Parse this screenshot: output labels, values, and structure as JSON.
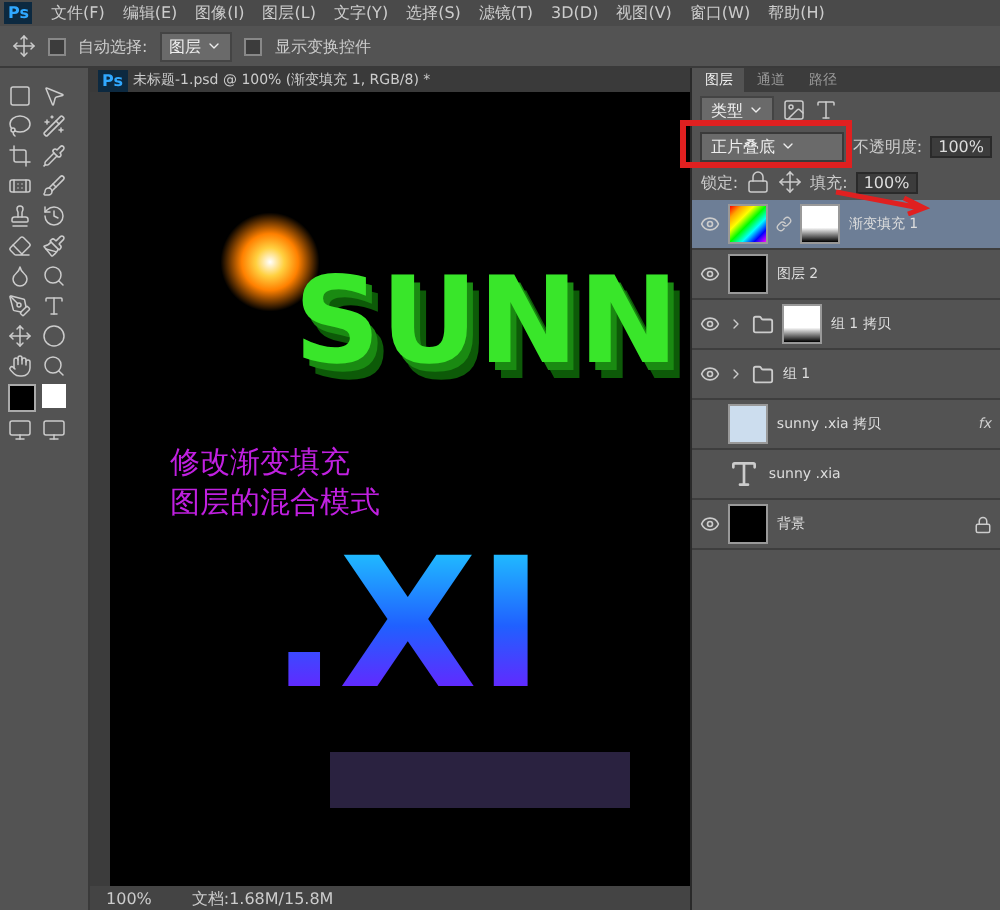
{
  "menu_bar": {
    "logo": "Ps",
    "items": [
      "文件(F)",
      "编辑(E)",
      "图像(I)",
      "图层(L)",
      "文字(Y)",
      "选择(S)",
      "滤镜(T)",
      "3D(D)",
      "视图(V)",
      "窗口(W)",
      "帮助(H)"
    ]
  },
  "options_bar": {
    "auto_select": {
      "label": "自动选择:",
      "checked": false
    },
    "target": "图层",
    "show_transform": {
      "label": "显示变换控件",
      "checked": false
    }
  },
  "document_tab": {
    "icon": "Ps",
    "title": "未标题-1.psd @ 100% (渐变填充 1, RGB/8) *"
  },
  "canvas": {
    "art_top": "SUNN",
    "art_bottom": ".XI",
    "caption": [
      "修改渐变填充",
      "图层的混合模式"
    ]
  },
  "status_bar": {
    "zoom": "100%",
    "doc_info": "文档:1.68M/15.8M"
  },
  "layers_panel": {
    "tabs": [
      {
        "label": "图层",
        "selected": true
      },
      {
        "label": "通道",
        "selected": false
      },
      {
        "label": "路径",
        "selected": false
      }
    ],
    "filter": "类型",
    "blend_mode": "正片叠底",
    "opacity_label": "不透明度:",
    "opacity": "100%",
    "lock_label": "锁定:",
    "fill_label": "填充:",
    "fill": "100%",
    "layers": [
      {
        "name": "渐变填充 1",
        "kind": "fill",
        "visible": true,
        "selected": true
      },
      {
        "name": "图层 2",
        "kind": "raster",
        "visible": true,
        "selected": false
      },
      {
        "name": "组 1 拷贝",
        "kind": "group",
        "visible": true,
        "selected": false,
        "expanded": false,
        "mask": true
      },
      {
        "name": "组 1",
        "kind": "group",
        "visible": true,
        "selected": false,
        "expanded": false,
        "mask": false
      },
      {
        "name": "sunny .xia 拷贝",
        "kind": "smart",
        "visible": false,
        "selected": false,
        "fx": "fx"
      },
      {
        "name": "sunny .xia",
        "kind": "text",
        "visible": false,
        "selected": false
      },
      {
        "name": "背景",
        "kind": "background",
        "visible": true,
        "selected": false
      }
    ]
  }
}
